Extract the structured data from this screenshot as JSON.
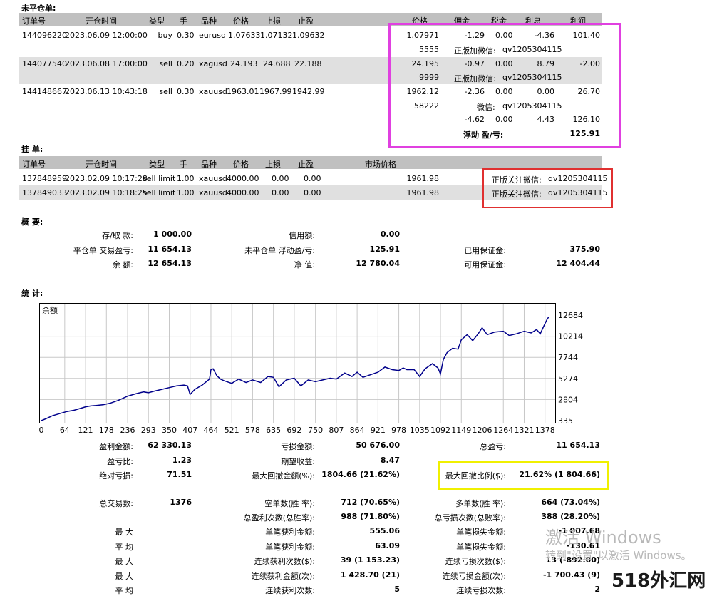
{
  "open_orders": {
    "title": "未平仓单:",
    "headers": [
      "订单号",
      "开仓时间",
      "类型",
      "手",
      "品种",
      "价格",
      "止损",
      "止盈",
      "价格",
      "佣金",
      "税金",
      "利息",
      "利润"
    ],
    "rows": [
      {
        "order": "144096220",
        "time": "2023.06.09 12:00:00",
        "type": "buy",
        "lots": "0.30",
        "symbol": "eurusd",
        "price": "1.07633",
        "sl": "1.07132",
        "tp": "1.09632",
        "cur": "1.07971",
        "commission": "-1.29",
        "tax": "0.00",
        "swap": "-4.36",
        "profit": "101.40",
        "sub_id": "5555",
        "sub_note": "正版加微信:",
        "sub_wx": "qv1205304115"
      },
      {
        "order": "144077540",
        "time": "2023.06.08 17:00:00",
        "type": "sell",
        "lots": "0.20",
        "symbol": "xagusd",
        "price": "24.193",
        "sl": "24.688",
        "tp": "22.188",
        "cur": "24.195",
        "commission": "-0.97",
        "tax": "0.00",
        "swap": "8.79",
        "profit": "-2.00",
        "sub_id": "9999",
        "sub_note": "正版加微信:",
        "sub_wx": "qv1205304115"
      },
      {
        "order": "144148667",
        "time": "2023.06.13 10:43:18",
        "type": "sell",
        "lots": "0.30",
        "symbol": "xauusd",
        "price": "1963.01",
        "sl": "1967.99",
        "tp": "1942.99",
        "cur": "1962.12",
        "commission": "-2.36",
        "tax": "0.00",
        "swap": "0.00",
        "profit": "26.70",
        "sub_id": "58222",
        "sub_note": "微信:",
        "sub_wx": "qv1205304115"
      }
    ],
    "totals": {
      "commission": "-4.62",
      "tax": "0.00",
      "swap": "4.43",
      "profit": "126.10"
    },
    "floating_label": "浮动 盈/亏:",
    "floating_value": "125.91"
  },
  "pending_orders": {
    "title": "挂 单:",
    "headers": [
      "订单号",
      "开仓时间",
      "类型",
      "手",
      "品种",
      "价格",
      "止损",
      "止盈",
      "市场价格"
    ],
    "rows": [
      {
        "order": "137848959",
        "time": "2023.02.09 10:17:28",
        "type": "sell limit",
        "lots": "1.00",
        "symbol": "xauusd",
        "price": "4000.00",
        "sl": "0.00",
        "tp": "0.00",
        "market": "1961.98",
        "note": "正版关注微信:",
        "wx": "qv1205304115"
      },
      {
        "order": "137849033",
        "time": "2023.02.09 10:18:25",
        "type": "sell limit",
        "lots": "1.00",
        "symbol": "xauusd",
        "price": "4000.00",
        "sl": "0.00",
        "tp": "0.00",
        "market": "1961.98",
        "note": "正版关注微信:",
        "wx": "qv1205304115"
      }
    ]
  },
  "summary": {
    "title": "概 要:",
    "deposit_label": "存/取 款:",
    "deposit": "1 000.00",
    "credit_label": "信用额:",
    "credit": "0.00",
    "closed_pl_label": "平仓单 交易盈亏:",
    "closed_pl": "11 654.13",
    "floating_pl_label": "未平仓单 浮动盈/亏:",
    "floating_pl": "125.91",
    "margin_label": "已用保证金:",
    "margin": "375.90",
    "balance_label": "余 额:",
    "balance": "12 654.13",
    "equity_label": "净 值:",
    "equity": "12 780.04",
    "free_margin_label": "可用保证金:",
    "free_margin": "12 404.44"
  },
  "stats_title": "统 计:",
  "chart_data": {
    "type": "line",
    "title": "余额",
    "x_ticks": [
      "0",
      "64",
      "121",
      "178",
      "236",
      "293",
      "350",
      "407",
      "464",
      "521",
      "578",
      "635",
      "692",
      "750",
      "807",
      "864",
      "921",
      "978",
      "1035",
      "1092",
      "1149",
      "1206",
      "1264",
      "1321",
      "1378"
    ],
    "y_ticks": [
      "12684",
      "10214",
      "7744",
      "5274",
      "2804",
      "335"
    ],
    "xlim": [
      0,
      1400
    ],
    "ylim": [
      335,
      12684
    ],
    "grid": true,
    "color": "#00008b",
    "series": [
      {
        "x": [
          0,
          15,
          30,
          50,
          70,
          90,
          110,
          121,
          135,
          150,
          170,
          190,
          210,
          236,
          260,
          280,
          293,
          310,
          330,
          350,
          370,
          390,
          400,
          407,
          420,
          440,
          460,
          464,
          470,
          480,
          490,
          500,
          521,
          540,
          560,
          578,
          600,
          620,
          635,
          650,
          670,
          692,
          710,
          730,
          750,
          770,
          790,
          807,
          830,
          850,
          864,
          880,
          900,
          921,
          940,
          960,
          978,
          990,
          1000,
          1020,
          1035,
          1050,
          1070,
          1085,
          1092,
          1100,
          1110,
          1125,
          1140,
          1149,
          1165,
          1180,
          1195,
          1206,
          1220,
          1240,
          1264,
          1280,
          1300,
          1321,
          1340,
          1355,
          1365,
          1378,
          1385,
          1390
        ],
        "y": [
          335,
          600,
          900,
          1150,
          1400,
          1550,
          1800,
          1950,
          2050,
          2100,
          2200,
          2400,
          2700,
          3200,
          3500,
          3700,
          3600,
          3800,
          4000,
          4200,
          4400,
          4500,
          4400,
          3400,
          4000,
          4500,
          5200,
          6300,
          6400,
          5600,
          5200,
          5000,
          4700,
          5200,
          4800,
          5100,
          4800,
          5500,
          5400,
          4300,
          5100,
          5300,
          4400,
          5100,
          4900,
          5100,
          5300,
          5200,
          5900,
          5500,
          6000,
          5400,
          5700,
          6000,
          6600,
          6300,
          6200,
          6500,
          6300,
          6300,
          5500,
          6400,
          7000,
          6500,
          5800,
          7500,
          8300,
          8800,
          8700,
          9800,
          10400,
          9700,
          10500,
          11200,
          10400,
          10700,
          10800,
          10300,
          10500,
          10800,
          10600,
          11000,
          10500,
          11700,
          12300,
          12500
        ]
      }
    ]
  },
  "stats": {
    "gross_profit_label": "盈利金额:",
    "gross_profit": "62 330.13",
    "gross_loss_label": "亏损金额:",
    "gross_loss": "50 676.00",
    "net_profit_label": "总盈亏:",
    "net_profit": "11 654.13",
    "profit_factor_label": "盈亏比:",
    "profit_factor": "1.23",
    "expected_label": "期望收益:",
    "expected": "8.47",
    "abs_dd_label": "绝对亏损:",
    "abs_dd": "71.51",
    "max_dd_label": "最大回撤金额(%):",
    "max_dd": "1804.66 (21.62%)",
    "rel_dd_label": "最大回撤比例($):",
    "rel_dd": "21.62% (1 804.66)",
    "total_trades_label": "总交易数:",
    "total_trades": "1376",
    "short_label": "空单数(胜 率):",
    "short": "712 (70.65%)",
    "long_label": "多单数(胜 率):",
    "long": "664 (73.04%)",
    "profit_trades_label": "总盈利次数(总胜率):",
    "profit_trades": "988 (71.80%)",
    "loss_trades_label": "总亏损次数(总败率):",
    "loss_trades": "388 (28.20%)",
    "largest_label": "最 大",
    "largest_profit_label": "单笔获利金额:",
    "largest_profit": "555.06",
    "largest_loss_label": "单笔损失金额:",
    "largest_loss": "-1 007.68",
    "average_label": "平 均",
    "avg_profit_label": "单笔获利金额:",
    "avg_profit": "63.09",
    "avg_loss_label": "单笔损失金额:",
    "avg_loss": "-130.61",
    "max1_label": "最 大",
    "consec_wins_label": "连续获利次数($):",
    "consec_wins": "39 (1 153.23)",
    "consec_losses_label": "连续亏损次数($):",
    "consec_losses": "13 (-892.00)",
    "max2_label": "最 大",
    "consec_profit_label": "连续获利金额(次):",
    "consec_profit": "1 428.70 (21)",
    "consec_loss_label": "连续亏损金额(次):",
    "consec_loss": "-1 700.43 (9)",
    "avg2_label": "平 均",
    "avg_consec_wins_label": "连续获利次数:",
    "avg_consec_wins": "5",
    "avg_consec_losses_label": "连续亏损次数:",
    "avg_consec_losses": "2"
  },
  "overlay": {
    "activate_title": "激活 Windows",
    "activate_sub": "转到\"设置\"以激活 Windows。",
    "watermark": "518外汇网"
  },
  "colors": {
    "header_bg": "#c0c0c0",
    "band_bg": "#e0e0e0",
    "magenta": "#e040e0",
    "red": "#e03030",
    "yellow": "#f0f000",
    "line": "#00008b"
  }
}
